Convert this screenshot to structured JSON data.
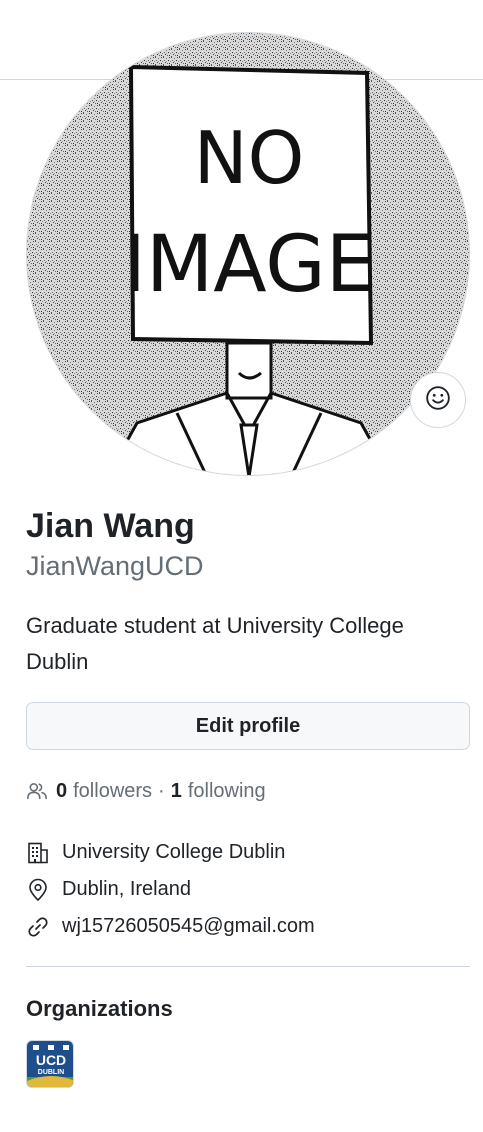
{
  "profile": {
    "avatar_text_line1": "NO",
    "avatar_text_line2": "IMAGE",
    "name": "Jian Wang",
    "login": "JianWangUCD",
    "bio": "Graduate student at University College Dublin",
    "edit_label": "Edit profile"
  },
  "social": {
    "followers_count": "0",
    "followers_label": "followers",
    "separator": "·",
    "following_count": "1",
    "following_label": "following"
  },
  "details": {
    "organization": "University College Dublin",
    "location": "Dublin, Ireland",
    "email": "wj15726050545@gmail.com"
  },
  "organizations": {
    "title": "Organizations",
    "items": [
      {
        "logo_text_top": "UCD",
        "logo_text_bottom": "DUBLIN",
        "color": "#1f4e8c"
      }
    ]
  },
  "icons": {
    "status": "smiley-icon",
    "people": "people-icon",
    "organization": "building-icon",
    "location": "location-pin-icon",
    "link": "link-icon"
  },
  "colors": {
    "text": "#1f2328",
    "muted": "#656d76",
    "border": "#d0d7de",
    "button_bg": "#f6f8fa"
  }
}
